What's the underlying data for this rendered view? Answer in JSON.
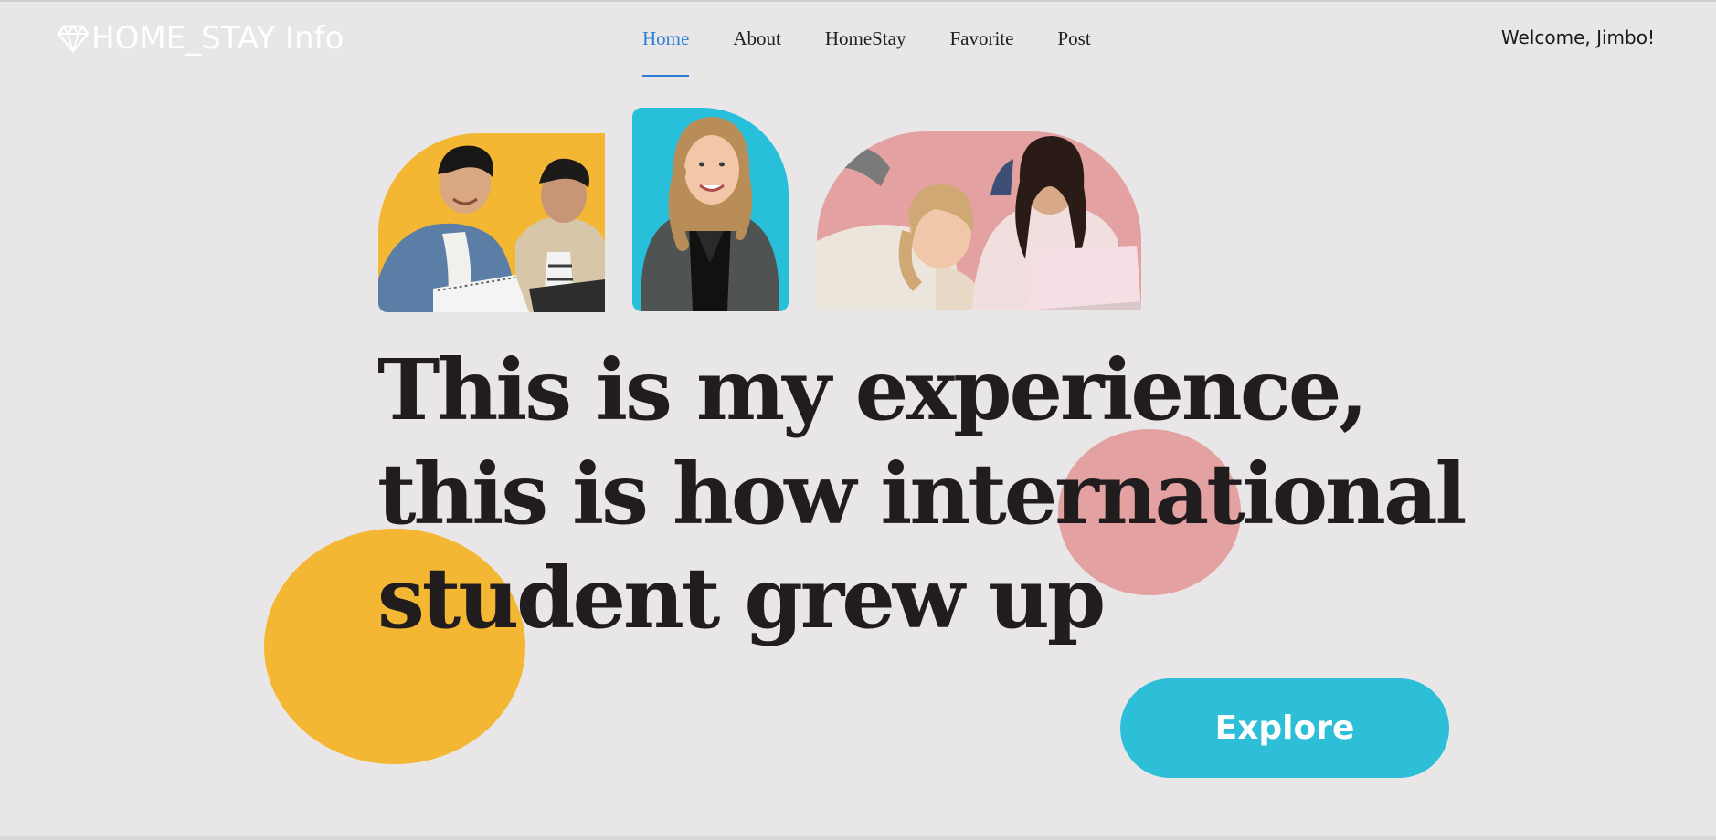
{
  "header": {
    "brand": {
      "icon": "diamond-icon",
      "title": "HOME_STAY Info"
    },
    "nav": [
      {
        "label": "Home",
        "active": true
      },
      {
        "label": "About",
        "active": false
      },
      {
        "label": "HomeStay",
        "active": false
      },
      {
        "label": "Favorite",
        "active": false
      },
      {
        "label": "Post",
        "active": false
      }
    ],
    "welcome": "Welcome, Jimbo!"
  },
  "hero": {
    "headline_lines": [
      "This is my experience,",
      "this is how international",
      "student grew up"
    ],
    "cta_label": "Explore",
    "photos": [
      {
        "name": "students-studying-photo",
        "background": "#f3b733"
      },
      {
        "name": "smiling-student-photo",
        "background": "#27bfd9"
      },
      {
        "name": "girls-on-laptop-photo",
        "background": "#e3a1a1"
      }
    ]
  },
  "colors": {
    "background": "#e8e6e7",
    "accent_blue": "#2b7fd6",
    "cta": "#2dbfd8",
    "yellow": "#f3b733",
    "pink": "#e3a1a1",
    "text": "#211c1d"
  }
}
